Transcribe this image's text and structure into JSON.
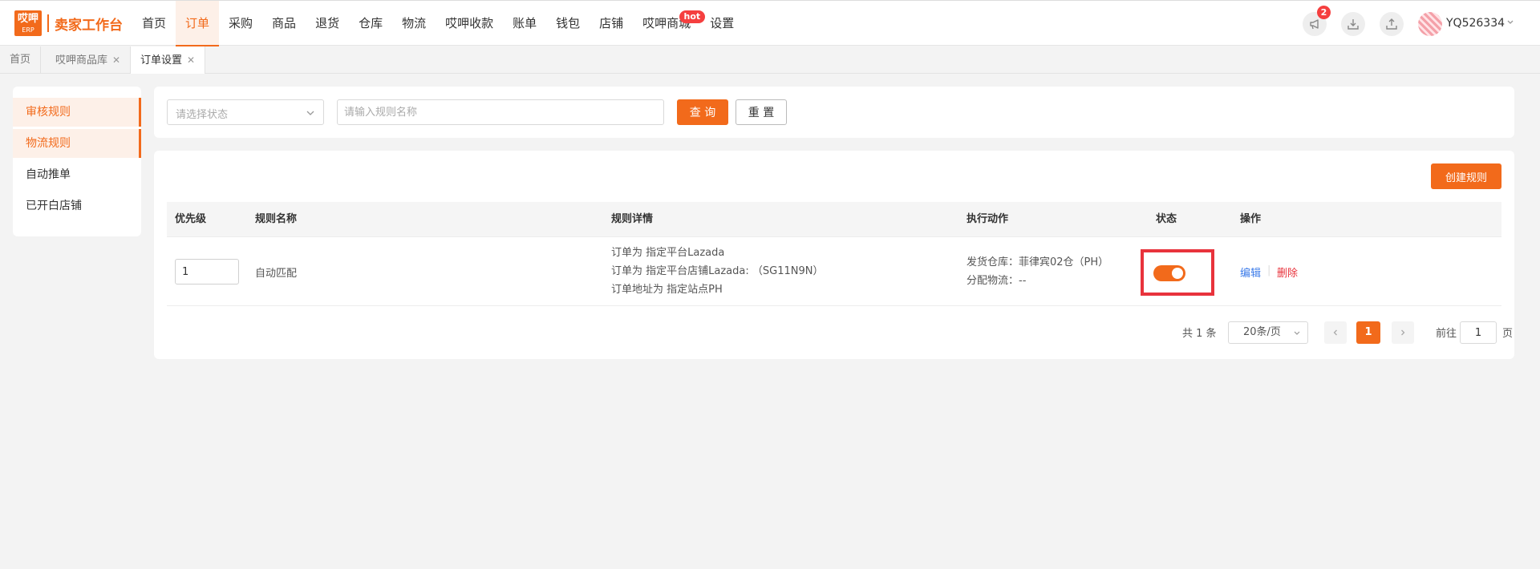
{
  "header": {
    "logo_top": "哎呷",
    "logo_bottom": "ERP",
    "brand": "卖家工作台",
    "nav": [
      {
        "label": "首页",
        "active": false
      },
      {
        "label": "订单",
        "active": true
      },
      {
        "label": "采购",
        "active": false
      },
      {
        "label": "商品",
        "active": false
      },
      {
        "label": "退货",
        "active": false
      },
      {
        "label": "仓库",
        "active": false
      },
      {
        "label": "物流",
        "active": false
      },
      {
        "label": "哎呷收款",
        "active": false
      },
      {
        "label": "账单",
        "active": false
      },
      {
        "label": "钱包",
        "active": false
      },
      {
        "label": "店铺",
        "active": false
      },
      {
        "label": "哎呷商城",
        "active": false,
        "badge": "hot"
      },
      {
        "label": "设置",
        "active": false
      }
    ],
    "notification_count": "2",
    "icons": [
      "megaphone-icon",
      "download-icon",
      "upload-icon"
    ],
    "username": "YQ526334"
  },
  "tabs": [
    {
      "label": "首页",
      "closable": false,
      "active": false
    },
    {
      "label": "哎呷商品库",
      "closable": true,
      "active": false
    },
    {
      "label": "订单设置",
      "closable": true,
      "active": true
    }
  ],
  "sidebar": {
    "items": [
      {
        "label": "审核规则",
        "active": true
      },
      {
        "label": "物流规则",
        "active": true
      },
      {
        "label": "自动推单",
        "active": false
      },
      {
        "label": "已开白店铺",
        "active": false
      }
    ]
  },
  "filter": {
    "status_placeholder": "请选择状态",
    "name_placeholder": "请输入规则名称",
    "query_label": "查 询",
    "reset_label": "重 置"
  },
  "table": {
    "create_label": "创建规则",
    "columns": [
      "优先级",
      "规则名称",
      "规则详情",
      "执行动作",
      "状态",
      "操作"
    ],
    "rows": [
      {
        "priority": "1",
        "name": "自动匹配",
        "details": [
          "订单为 指定平台Lazada",
          "订单为 指定平台店铺Lazada: （SG11N9N）",
          "订单地址为 指定站点PH"
        ],
        "actions": [
          "发货仓库：菲律宾02仓（PH）",
          "分配物流：--"
        ],
        "status_on": true,
        "edit_label": "编辑",
        "separator": "|",
        "delete_label": "删除"
      }
    ]
  },
  "pagination": {
    "total": "共 1 条",
    "page_size": "20条/页",
    "current_page": "1",
    "goto_label": "前往",
    "goto_value": "1",
    "page_unit": "页"
  },
  "colors": {
    "accent": "#f26a1b",
    "highlight_box": "#e8333c",
    "link": "#3b7be9",
    "danger": "#e8333c"
  }
}
